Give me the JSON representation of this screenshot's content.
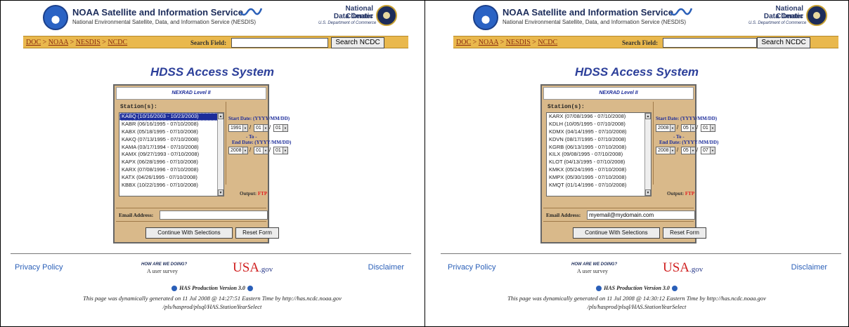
{
  "panels": [
    {
      "noaa_title": "NOAA Satellite and Information Service",
      "noaa_subtitle": "National Environmental Satellite, Data, and Information Service (NESDIS)",
      "ncdc_name_line1": "National Climatic",
      "ncdc_name_line2": "Data Center",
      "ncdc_dept": "U.S. Department of Commerce",
      "breadcrumb": [
        "DOC",
        "NOAA",
        "NESDIS",
        "NCDC"
      ],
      "search_label": "Search Field:",
      "search_value": "",
      "search_button": "Search NCDC",
      "page_title": "HDSS Access System",
      "form_header": "NEXRAD Level II",
      "station_label": "Station(s):",
      "stations": [
        "KABQ (10/16/2003 - 10/23/2003)",
        "KABR (06/16/1995 - 07/10/2008)",
        "KABX (05/18/1995 - 07/10/2008)",
        "KAKQ (07/13/1995 - 07/10/2008)",
        "KAMA (03/17/1994 - 07/10/2008)",
        "KAMX (09/27/1993 - 07/10/2008)",
        "KAPX (06/28/1996 - 07/10/2008)",
        "KARX (07/08/1996 - 07/10/2008)",
        "KATX (04/26/1995 - 07/10/2008)",
        "KBBX (10/22/1996 - 07/10/2008)"
      ],
      "selected_index": 0,
      "start_date_label": "Start Date: (YYYY/MM/DD)",
      "start_year": "1991",
      "start_month": "01",
      "start_day": "01",
      "to_label": "- To -",
      "end_date_label": "End Date: (YYYY/MM/DD)",
      "end_year": "2008",
      "end_month": "01",
      "end_day": "01",
      "output_label": "Output:",
      "output_value": "FTP",
      "email_label": "Email Address:",
      "email_value": "",
      "continue_button": "Continue With Selections",
      "reset_button": "Reset Form",
      "privacy": "Privacy Policy",
      "survey_title": "HOW ARE WE DOING?",
      "survey_sub": "A user survey",
      "usagov_usa": "USA",
      "usagov_gov": ".gov",
      "disclaimer": "Disclaimer",
      "has_version": "HAS Production Version 3.0",
      "generated_line1": "This page was dynamically generated on 11 Jul 2008 @ 14:27:51 Eastern Time by http://has.ncdc.noaa.gov",
      "generated_line2": "/pls/hasprod/plsql/HAS.StationYearSelect"
    },
    {
      "noaa_title": "NOAA Satellite and Information Service",
      "noaa_subtitle": "National Environmental Satellite, Data, and Information Service (NESDIS)",
      "ncdc_name_line1": "National Climatic",
      "ncdc_name_line2": "Data Center",
      "ncdc_dept": "U.S. Department of Commerce",
      "breadcrumb": [
        "DOC",
        "NOAA",
        "NESDIS",
        "NCDC"
      ],
      "search_label": "Search Field:",
      "search_value": "",
      "search_button": "Search NCDC",
      "page_title": "HDSS Access System",
      "form_header": "NEXRAD Level II",
      "station_label": "Station(s):",
      "stations": [
        "KARX (07/08/1996 - 07/10/2008)",
        "KDLH (10/05/1995 - 07/10/2008)",
        "KDMX (04/14/1995 - 07/10/2008)",
        "KDVN (08/17/1995 - 07/10/2008)",
        "KGRB (06/13/1995 - 07/10/2008)",
        "KILX (09/08/1995 - 07/10/2008)",
        "KLOT (04/13/1995 - 07/10/2008)",
        "KMKX (05/24/1995 - 07/10/2008)",
        "KMPX (05/30/1995 - 07/10/2008)",
        "KMQT (01/14/1996 - 07/10/2008)"
      ],
      "selected_index": -1,
      "start_date_label": "Start Date: (YYYY/MM/DD)",
      "start_year": "2008",
      "start_month": "05",
      "start_day": "01",
      "to_label": "- To -",
      "end_date_label": "End Date: (YYYY/MM/DD)",
      "end_year": "2008",
      "end_month": "05",
      "end_day": "07",
      "output_label": "Output:",
      "output_value": "FTP",
      "email_label": "Email Address:",
      "email_value": "myemail@mydomain.com",
      "continue_button": "Continue With Selections",
      "reset_button": "Reset Form",
      "privacy": "Privacy Policy",
      "survey_title": "HOW ARE WE DOING?",
      "survey_sub": "A user survey",
      "usagov_usa": "USA",
      "usagov_gov": ".gov",
      "disclaimer": "Disclaimer",
      "has_version": "HAS Production Version 3.0",
      "generated_line1": "This page was dynamically generated on 11 Jul 2008 @ 14:30:12 Eastern Time by http://has.ncdc.noaa.gov",
      "generated_line2": "/pls/hasprod/plsql/HAS.StationYearSelect"
    }
  ]
}
